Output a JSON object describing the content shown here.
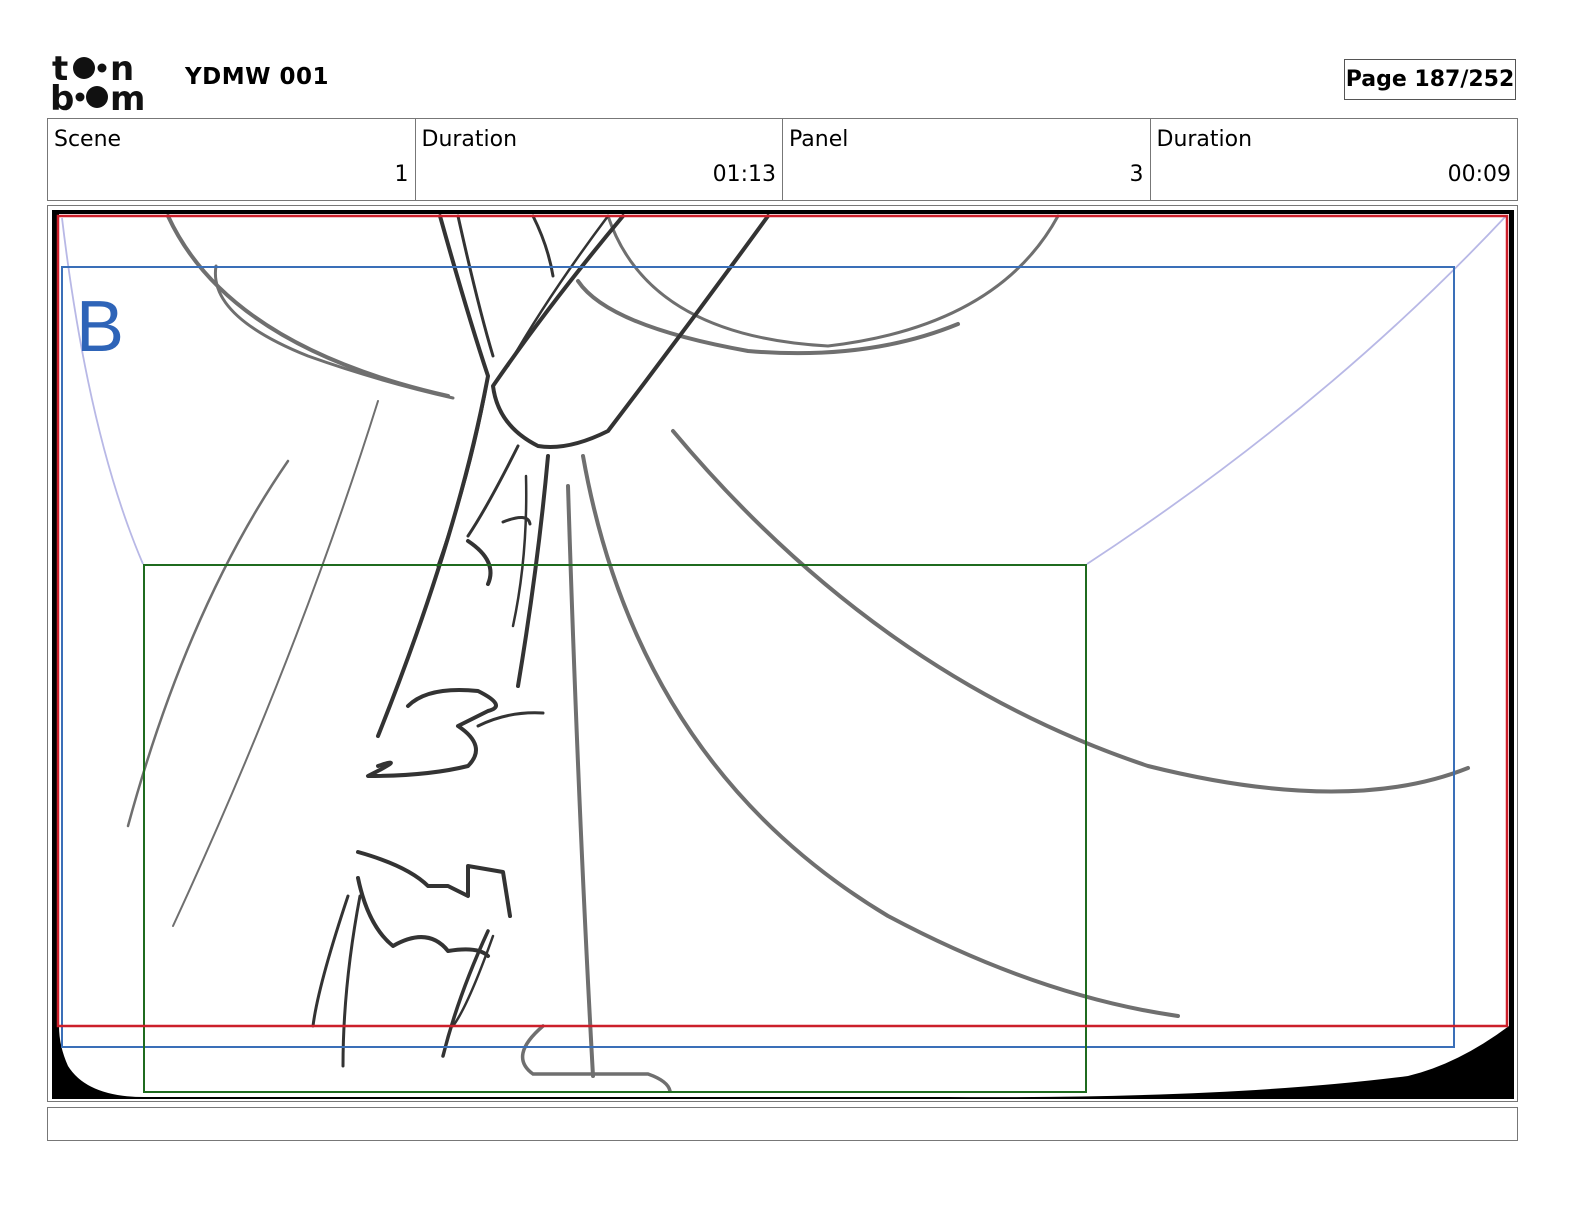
{
  "header": {
    "logo_alt": "toon boom",
    "project_title": "YDMW 001",
    "page_label": "Page 187/252"
  },
  "info": {
    "scene_label": "Scene",
    "scene_value": "1",
    "scene_duration_label": "Duration",
    "scene_duration_value": "01:13",
    "panel_label": "Panel",
    "panel_value": "3",
    "panel_duration_label": "Duration",
    "panel_duration_value": "00:09"
  },
  "panel": {
    "frame_marker": "B",
    "colors": {
      "safe_red": "#cc1f2a",
      "field_blue": "#3a6fb8",
      "marker_blue": "#2e64b8",
      "camera_green": "#1f6b1f",
      "guide_lavender": "#b8b8e6",
      "sketch_dark": "#333333",
      "sketch_mid": "#6f6f6f"
    }
  },
  "caption": {
    "text": ""
  }
}
